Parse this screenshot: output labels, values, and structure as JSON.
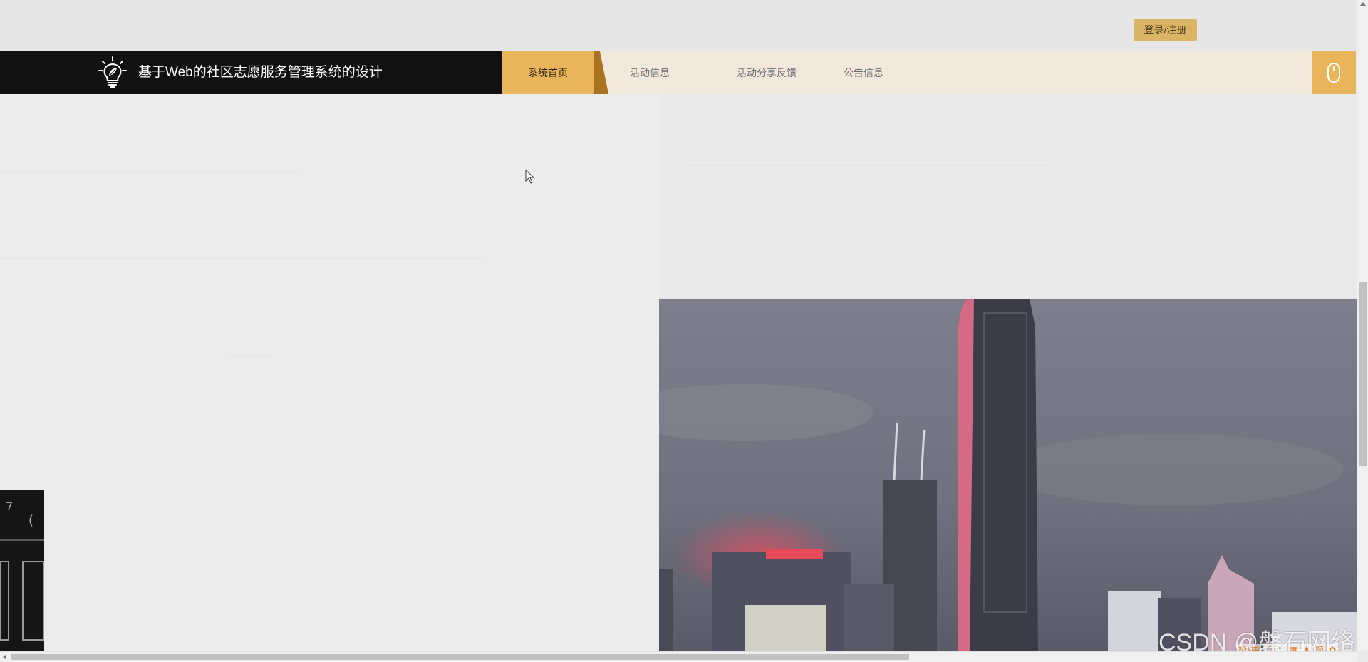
{
  "header": {
    "login_label": "登录/注册"
  },
  "brand": {
    "title": "基于Web的社区志愿服务管理系统的设计",
    "logo_icon": "lightbulb-leaf-icon"
  },
  "nav": {
    "items": [
      {
        "label": "系统首页",
        "active": true
      },
      {
        "label": "活动信息",
        "active": false
      },
      {
        "label": "活动分享反馈",
        "active": false
      },
      {
        "label": "公告信息",
        "active": false
      }
    ],
    "mouse_icon": "mouse-icon"
  },
  "watermark": {
    "text": "CSDN @磐石网络"
  },
  "ime": {
    "items": [
      "极",
      "中",
      "☽",
      "°,",
      "▦",
      "♟",
      "简",
      "✿"
    ]
  },
  "colors": {
    "accent": "#e8b55a",
    "brand_bg": "#111111",
    "nav_bg": "#f2e9dc",
    "login_bg": "#dcb466"
  }
}
